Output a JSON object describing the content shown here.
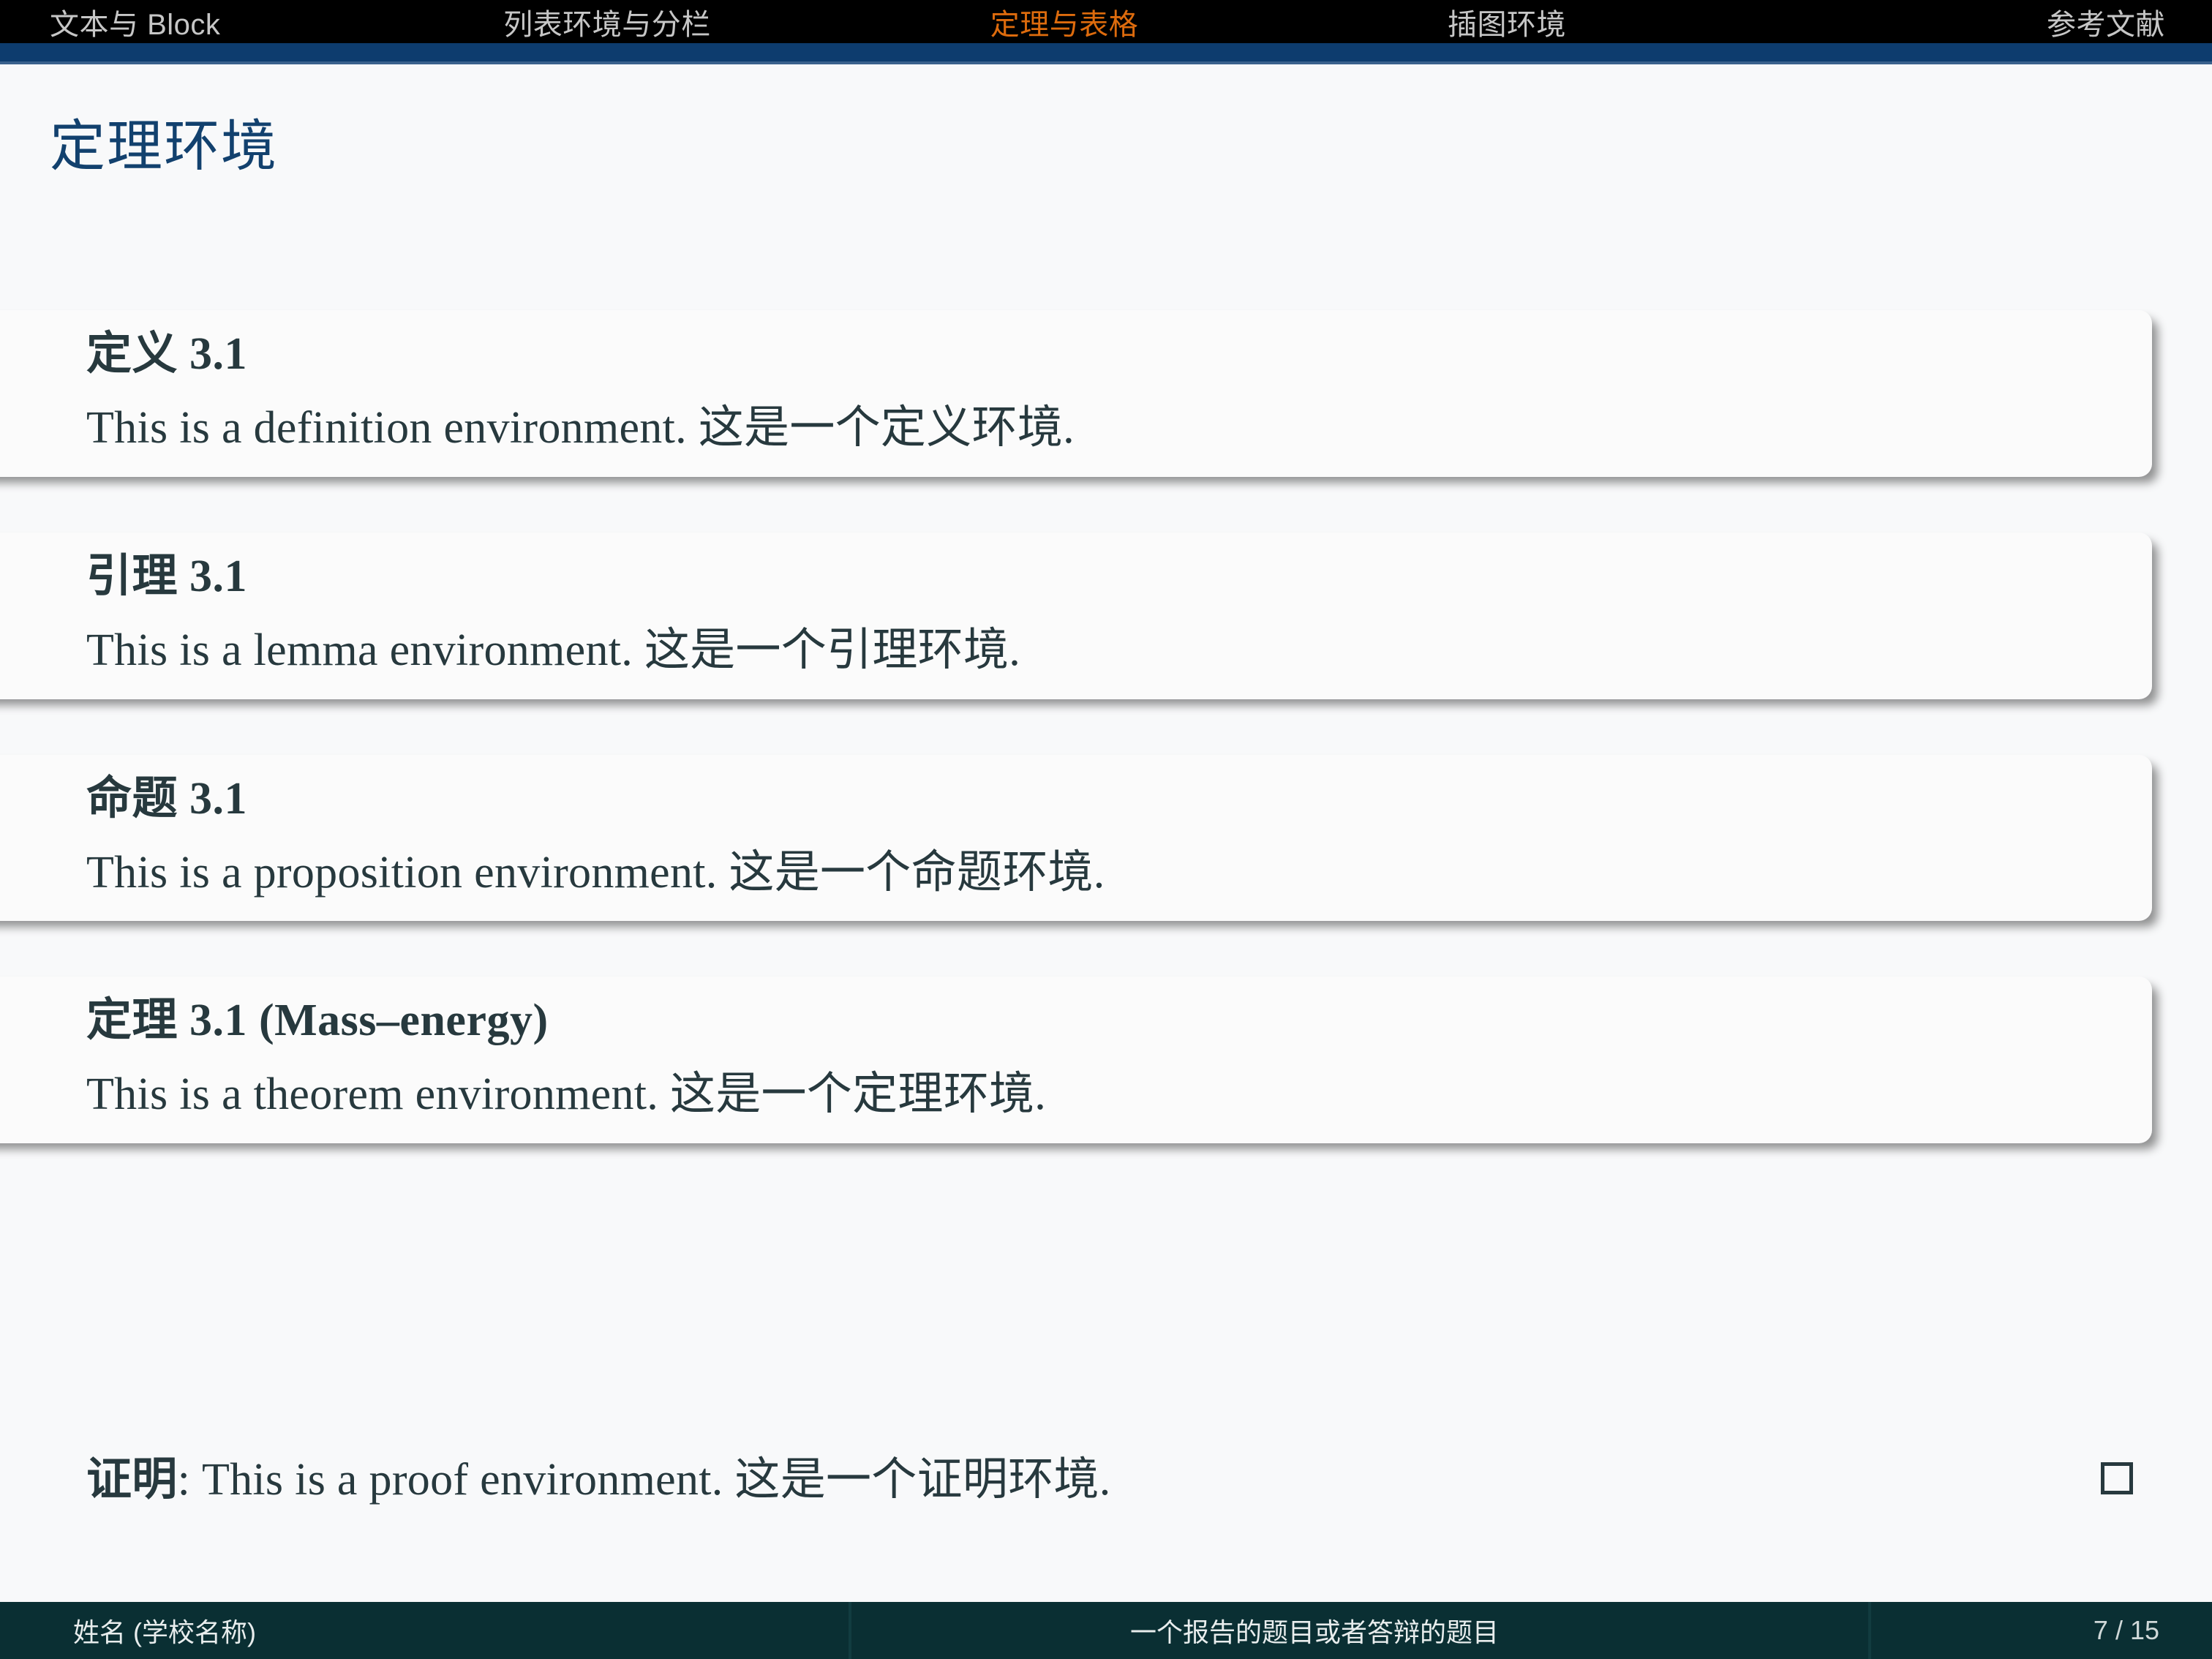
{
  "navbar": {
    "items": [
      {
        "label": "文本与 Block",
        "active": false
      },
      {
        "label": "列表环境与分栏",
        "active": false
      },
      {
        "label": "定理与表格",
        "active": true
      },
      {
        "label": "插图环境",
        "active": false
      },
      {
        "label": "参考文献",
        "active": false
      }
    ],
    "active_color": "#dd6b0d",
    "inactive_color": "#c6c6c6",
    "background": "#000000"
  },
  "accent": {
    "rule_blue": "#0d3c6e",
    "title_blue": "#12416e",
    "text_slate": "#27393e",
    "footer_bg": "#0a2f33",
    "slide_bg": "#f8f9fa"
  },
  "frame": {
    "title": "定理环境"
  },
  "blocks": [
    {
      "title": "定义 3.1",
      "body": "This is a definition environment. 这是一个定义环境."
    },
    {
      "title": "引理 3.1",
      "body": "This is a lemma environment. 这是一个引理环境."
    },
    {
      "title": "命题 3.1",
      "body": "This is a proposition environment. 这是一个命题环境."
    },
    {
      "title": "定理 3.1 (Mass–energy)",
      "body": "This is a theorem environment. 这是一个定理环境."
    }
  ],
  "proof": {
    "label": "证明",
    "separator": ": ",
    "text": "This is a proof environment. 这是一个证明环境.",
    "qed_symbol": "□"
  },
  "footer": {
    "author": "姓名 (学校名称)",
    "title": "一个报告的题目或者答辩的题目",
    "page": "7 / 15"
  }
}
